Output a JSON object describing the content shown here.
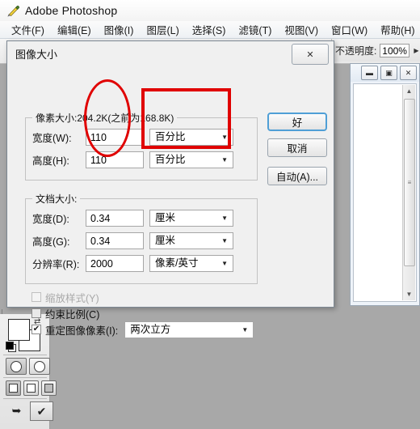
{
  "app": {
    "title": "Adobe Photoshop",
    "icon": "photoshop-pen-icon",
    "menu": [
      {
        "label": "文件(F)"
      },
      {
        "label": "编辑(E)"
      },
      {
        "label": "图像(I)"
      },
      {
        "label": "图层(L)"
      },
      {
        "label": "选择(S)"
      },
      {
        "label": "滤镜(T)"
      },
      {
        "label": "视图(V)"
      },
      {
        "label": "窗口(W)"
      },
      {
        "label": "帮助(H)"
      }
    ]
  },
  "options_bar": {
    "opacity_label": "不透明度:",
    "opacity_value": "100%",
    "opacity_arrow": "▶"
  },
  "doc_window": {
    "minimize": "▬",
    "restore": "▣",
    "close": "✕",
    "scroll_up": "▲",
    "scroll_down": "▼",
    "thumb_grip": "≡"
  },
  "dialog": {
    "title": "图像大小",
    "close_glyph": "✕",
    "pixel_group": {
      "legend": "像素大小:204.2K(之前为168.8K)",
      "rows": [
        {
          "label": "宽度(W):",
          "value": "110",
          "unit": "百分比",
          "caret": "▼"
        },
        {
          "label": "高度(H):",
          "value": "110",
          "unit": "百分比",
          "caret": "▼"
        }
      ]
    },
    "doc_group": {
      "legend": "文档大小:",
      "rows": [
        {
          "label": "宽度(D):",
          "value": "0.34",
          "unit": "厘米",
          "caret": "▼"
        },
        {
          "label": "高度(G):",
          "value": "0.34",
          "unit": "厘米",
          "caret": "▼"
        },
        {
          "label": "分辨率(R):",
          "value": "2000",
          "unit": "像素/英寸",
          "caret": "▼"
        }
      ]
    },
    "checkboxes": [
      {
        "label": "缩放样式(Y)",
        "checked": false,
        "enabled": false,
        "mark": ""
      },
      {
        "label": "约束比例(C)",
        "checked": false,
        "enabled": true,
        "mark": ""
      },
      {
        "label": "重定图像像素(I):",
        "checked": true,
        "enabled": true,
        "mark": "✔"
      }
    ],
    "resample_method": "两次立方",
    "resample_caret": "▼",
    "buttons": {
      "ok": "好",
      "cancel": "取消",
      "auto": "自动(A)..."
    }
  },
  "annotations": {
    "accent_color": "#e00000",
    "ellipse_target": "宽度/高度数值 110",
    "rect_target": "百分比单位下拉"
  },
  "toolbox": {
    "swap_glyph": "⇄",
    "quick_mask_standard": "standard-mode",
    "quick_mask_quick": "quick-mask-mode",
    "screen_modes": [
      "standard-screen",
      "full-screen-menubar",
      "full-screen"
    ],
    "jump_glyph": "➥",
    "imageready_glyph": "✔"
  }
}
